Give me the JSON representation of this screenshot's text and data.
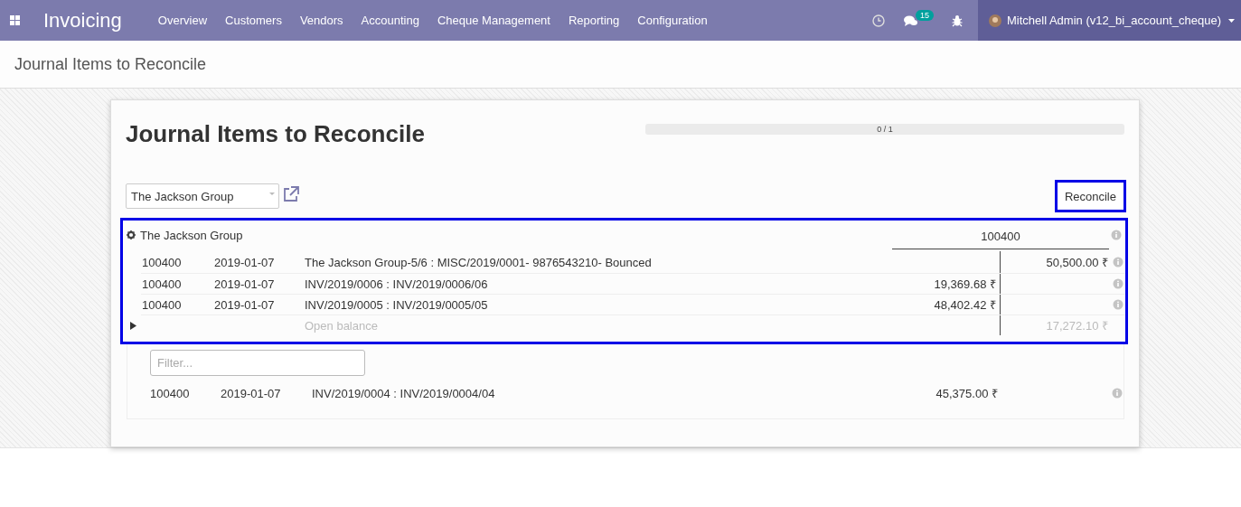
{
  "navbar": {
    "app_title": "Invoicing",
    "menu": [
      "Overview",
      "Customers",
      "Vendors",
      "Accounting",
      "Cheque Management",
      "Reporting",
      "Configuration"
    ],
    "messages_badge": "15",
    "user": "Mitchell Admin (v12_bi_account_cheque)"
  },
  "breadcrumb": "Journal Items to Reconcile",
  "reconcile": {
    "title": "Journal Items to Reconcile",
    "progress": {
      "text": "0 / 1",
      "level": 0
    },
    "partner_field": "The Jackson Group",
    "button": "Reconcile",
    "match": {
      "partner": "The Jackson Group",
      "account": "100400",
      "lines": [
        {
          "account": "100400",
          "date": "2019-01-07",
          "label": "The Jackson Group-5/6 : MISC/2019/0001- 9876543210- Bounced",
          "credit": "50,500.00 ₹"
        },
        {
          "account": "100400",
          "date": "2019-01-07",
          "label": "INV/2019/0006 : INV/2019/0006/06",
          "debit": "19,369.68 ₹"
        },
        {
          "account": "100400",
          "date": "2019-01-07",
          "label": "INV/2019/0005 : INV/2019/0005/05",
          "debit": "48,402.42 ₹"
        }
      ],
      "open_balance": {
        "label": "Open balance",
        "amount": "17,272.10 ₹"
      }
    },
    "filter": {
      "placeholder": "Filter..."
    },
    "proposals": [
      {
        "account": "100400",
        "date": "2019-01-07",
        "label": "INV/2019/0004 : INV/2019/0004/04",
        "amount": "45,375.00 ₹"
      }
    ]
  }
}
